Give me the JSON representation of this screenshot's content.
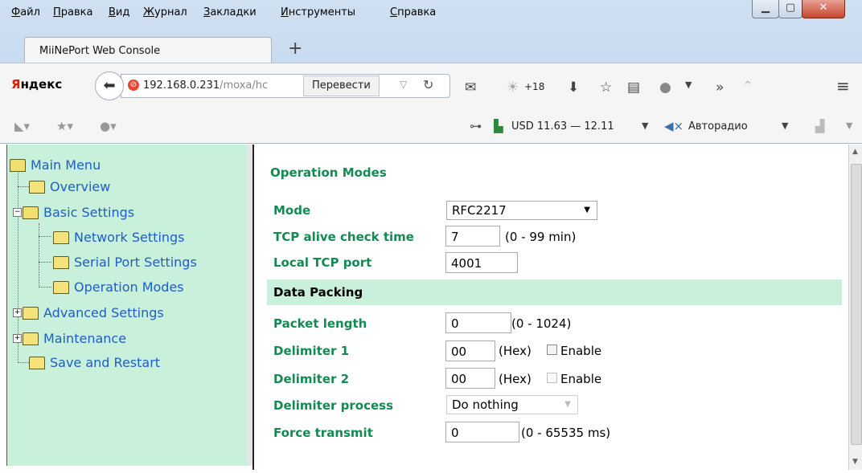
{
  "menu": [
    "Файл",
    "Правка",
    "Вид",
    "Журнал",
    "Закладки",
    "Инструменты",
    "Справка"
  ],
  "tab": {
    "title": "MiiNePort Web Console",
    "new_tab": "+"
  },
  "nav": {
    "brand_first": "Я",
    "brand_rest": "ндекс",
    "url_host": "192.168.0.231",
    "url_path": "/moxa/hc",
    "translate": "Перевести",
    "weather": "+18"
  },
  "bookmarks": {
    "currency": "USD 11.63 — 12.11",
    "radio": "Авторадио"
  },
  "sidebar": {
    "root": "Main Menu",
    "items": [
      "Overview",
      "Basic Settings",
      "Network Settings",
      "Serial Port Settings",
      "Operation Modes",
      "Advanced Settings",
      "Maintenance",
      "Save and Restart"
    ]
  },
  "form": {
    "title": "Operation Modes",
    "mode_label": "Mode",
    "mode_value": "RFC2217",
    "tcp_alive_label": "TCP alive check time",
    "tcp_alive_value": "7",
    "tcp_alive_hint": "(0 - 99 min)",
    "local_tcp_label": "Local TCP port",
    "local_tcp_value": "4001",
    "data_packing": "Data Packing",
    "packet_length_label": "Packet length",
    "packet_length_value": "0",
    "packet_length_hint": "(0 - 1024)",
    "delim1_label": "Delimiter 1",
    "delim1_value": "00",
    "delim1_hint": "(Hex)",
    "delim1_enable": "Enable",
    "delim2_label": "Delimiter 2",
    "delim2_value": "00",
    "delim2_hint": "(Hex)",
    "delim2_enable": "Enable",
    "delim_process_label": "Delimiter process",
    "delim_process_value": "Do nothing",
    "force_label": "Force transmit",
    "force_value": "0",
    "force_hint": "(0 - 65535 ms)"
  }
}
